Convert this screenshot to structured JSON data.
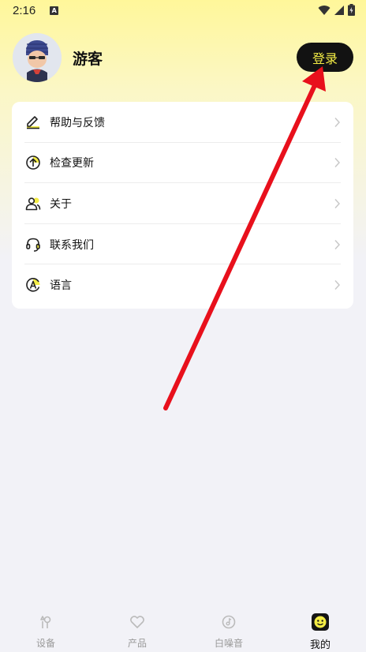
{
  "status_bar": {
    "time": "2:16",
    "notif_icon_letter": "A"
  },
  "profile": {
    "username": "游客",
    "login_label": "登录"
  },
  "menu": {
    "items": [
      {
        "label": "帮助与反馈",
        "icon": "edit-pencil-icon"
      },
      {
        "label": "检查更新",
        "icon": "upload-arrow-icon"
      },
      {
        "label": "关于",
        "icon": "people-icon"
      },
      {
        "label": "联系我们",
        "icon": "headset-icon"
      },
      {
        "label": "语言",
        "icon": "language-icon"
      }
    ]
  },
  "tabs": [
    {
      "label": "设备",
      "icon": "device-icon"
    },
    {
      "label": "产品",
      "icon": "heart-icon"
    },
    {
      "label": "白噪音",
      "icon": "music-disc-icon"
    },
    {
      "label": "我的",
      "icon": "smiley-icon",
      "active": true
    }
  ],
  "colors": {
    "accent_yellow": "#f3ec45",
    "annotation_red": "#e8101c",
    "dark": "#121212"
  }
}
